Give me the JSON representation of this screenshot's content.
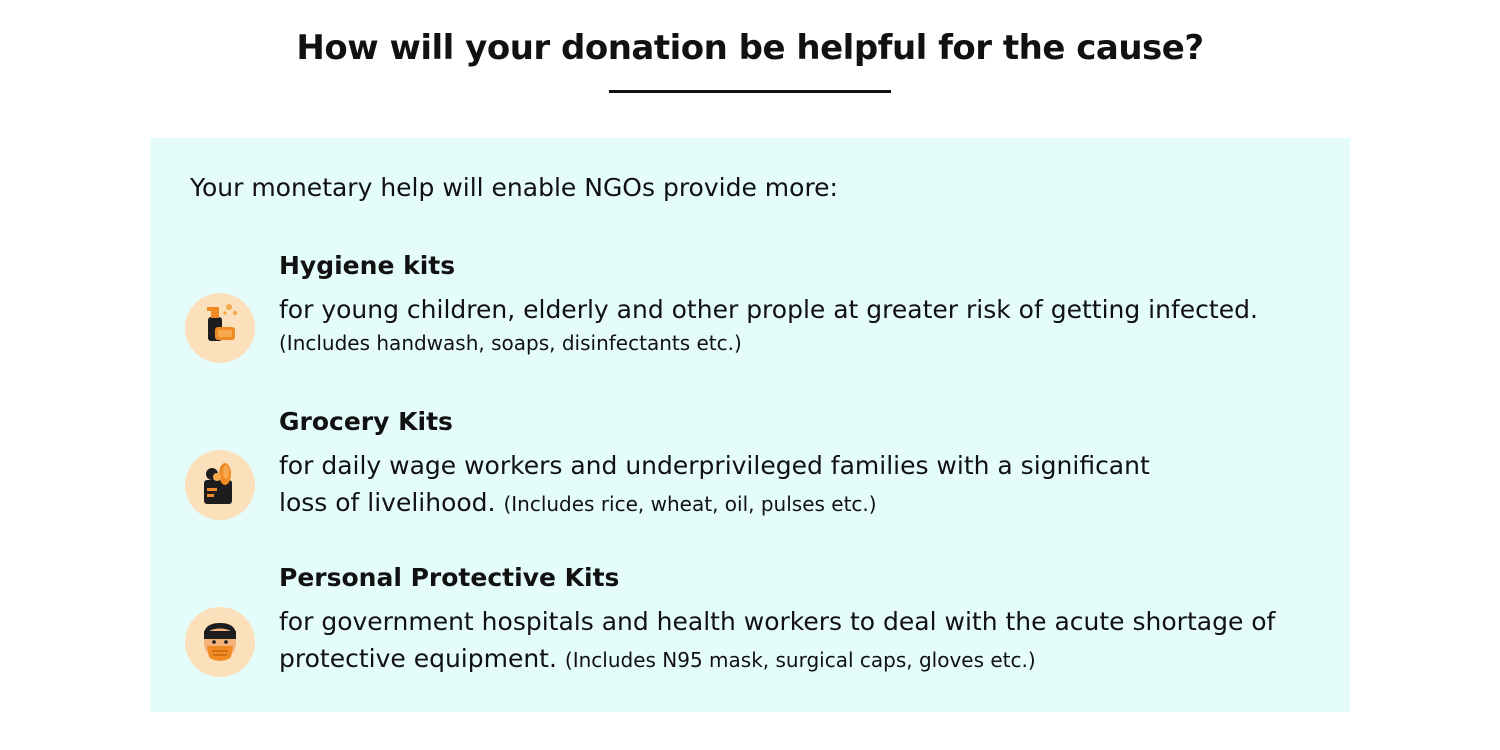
{
  "header": {
    "title": "How will your donation be helpful for the cause?"
  },
  "panel": {
    "background_color": "#e4fcfa",
    "intro": "Your monetary help will enable NGOs provide more:",
    "kits": [
      {
        "icon": "hygiene-kit-icon",
        "title": "Hygiene kits",
        "description_line1": "for young children, elderly and other prople at greater risk of getting infected.",
        "details": "(Includes handwash, soaps, disinfectants etc.)"
      },
      {
        "icon": "grocery-kit-icon",
        "title": "Grocery Kits",
        "description_line1": "for daily wage workers and underprivileged families with a significant",
        "description_line2": "loss of livelihood.",
        "details": "(Includes rice, wheat, oil, pulses etc.)"
      },
      {
        "icon": "protective-kit-icon",
        "title": "Personal Protective Kits",
        "description_line1": "for government hospitals and health workers to deal with the acute shortage of",
        "description_line2": "protective equipment.",
        "details": "(Includes N95 mask, surgical caps, gloves etc.)"
      }
    ]
  },
  "colors": {
    "icon_circle": "#fbe0bb",
    "accent_orange": "#f08a24",
    "icon_dark": "#1d1d1f"
  }
}
